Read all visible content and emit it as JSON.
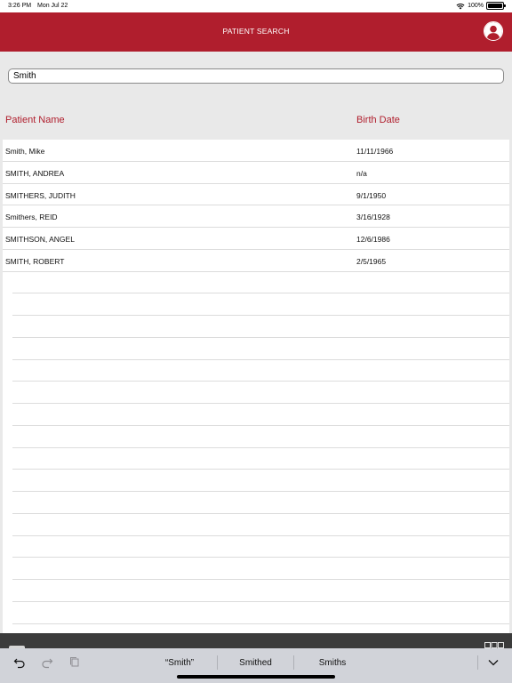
{
  "status": {
    "time": "3:26 PM",
    "date": "Mon Jul 22",
    "battery": "100%"
  },
  "header": {
    "title": "PATIENT SEARCH"
  },
  "search": {
    "value": "Smith"
  },
  "columns": {
    "name": "Patient Name",
    "dob": "Birth Date"
  },
  "patients": [
    {
      "name": "Smith, Mike",
      "dob": "11/11/1966"
    },
    {
      "name": "SMITH, ANDREA",
      "dob": "n/a"
    },
    {
      "name": "SMITHERS, JUDITH",
      "dob": "9/1/1950"
    },
    {
      "name": "Smithers, REID",
      "dob": "3/16/1928"
    },
    {
      "name": "SMITHSON, ANGEL",
      "dob": "12/6/1986"
    },
    {
      "name": "SMITH, ROBERT",
      "dob": "2/5/1965"
    }
  ],
  "keyboard": {
    "suggestions": [
      "“Smith”",
      "Smithed",
      "Smiths"
    ]
  },
  "colors": {
    "accent": "#b01e2d"
  },
  "icons": [
    "wifi-icon",
    "battery-icon",
    "user-icon",
    "scan-icon",
    "undo-icon",
    "redo-icon",
    "paste-icon",
    "chevron-down-icon"
  ]
}
